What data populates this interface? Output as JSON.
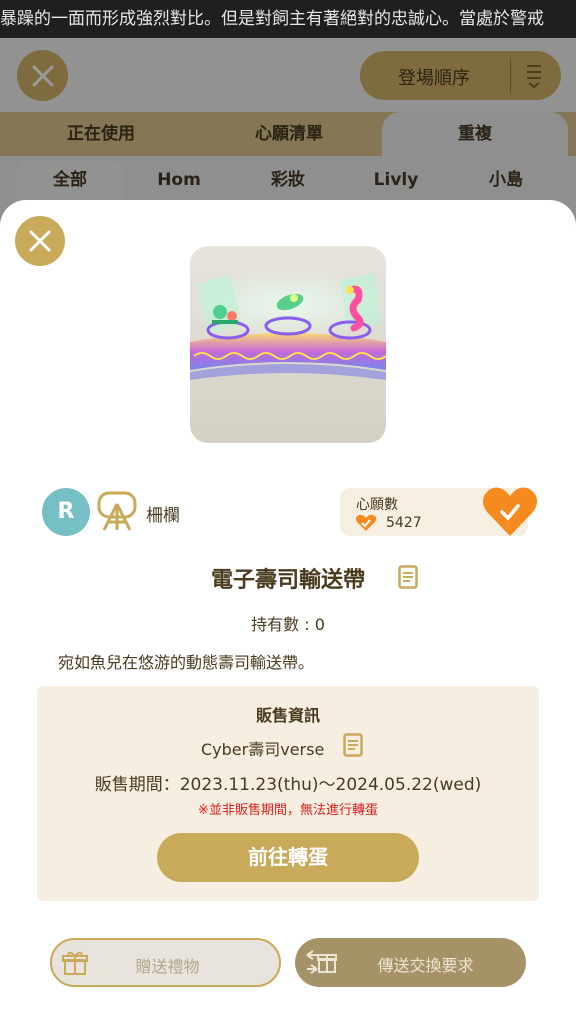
{
  "ticker": {
    "text": "暴躁的一面而形成強烈對比。但是對飼主有著絕對的忠誠心。當處於警戒"
  },
  "background": {
    "sort_label": "登場順序",
    "tabs": [
      "正在使用",
      "心願清單",
      "重複"
    ],
    "subtabs": [
      "全部",
      "Hom",
      "彩妝",
      "Livly",
      "小島"
    ]
  },
  "item": {
    "rarity": "R",
    "category": "柵欄",
    "wishlist_label": "心願數",
    "wishlist_count": "5427",
    "name": "電子壽司輸送帶",
    "owned": "持有數 : 0",
    "description": "宛如魚兒在悠游的動態壽司輸送帶。"
  },
  "sales": {
    "title": "販售資訊",
    "gacha_name": "Cyber壽司verse",
    "period": "販售期間：2023.11.23(thu)～2024.05.22(wed)",
    "warning": "※並非販售期間，無法進行轉蛋",
    "goto_button": "前往轉蛋"
  },
  "actions": {
    "gift_label": "贈送禮物",
    "trade_label": "傳送交換要求"
  },
  "colors": {
    "accent_gold": "#c9a95a",
    "wish_orange": "#f58a1f",
    "rarity_teal": "#76c0c5",
    "warning_red": "#e02020"
  }
}
